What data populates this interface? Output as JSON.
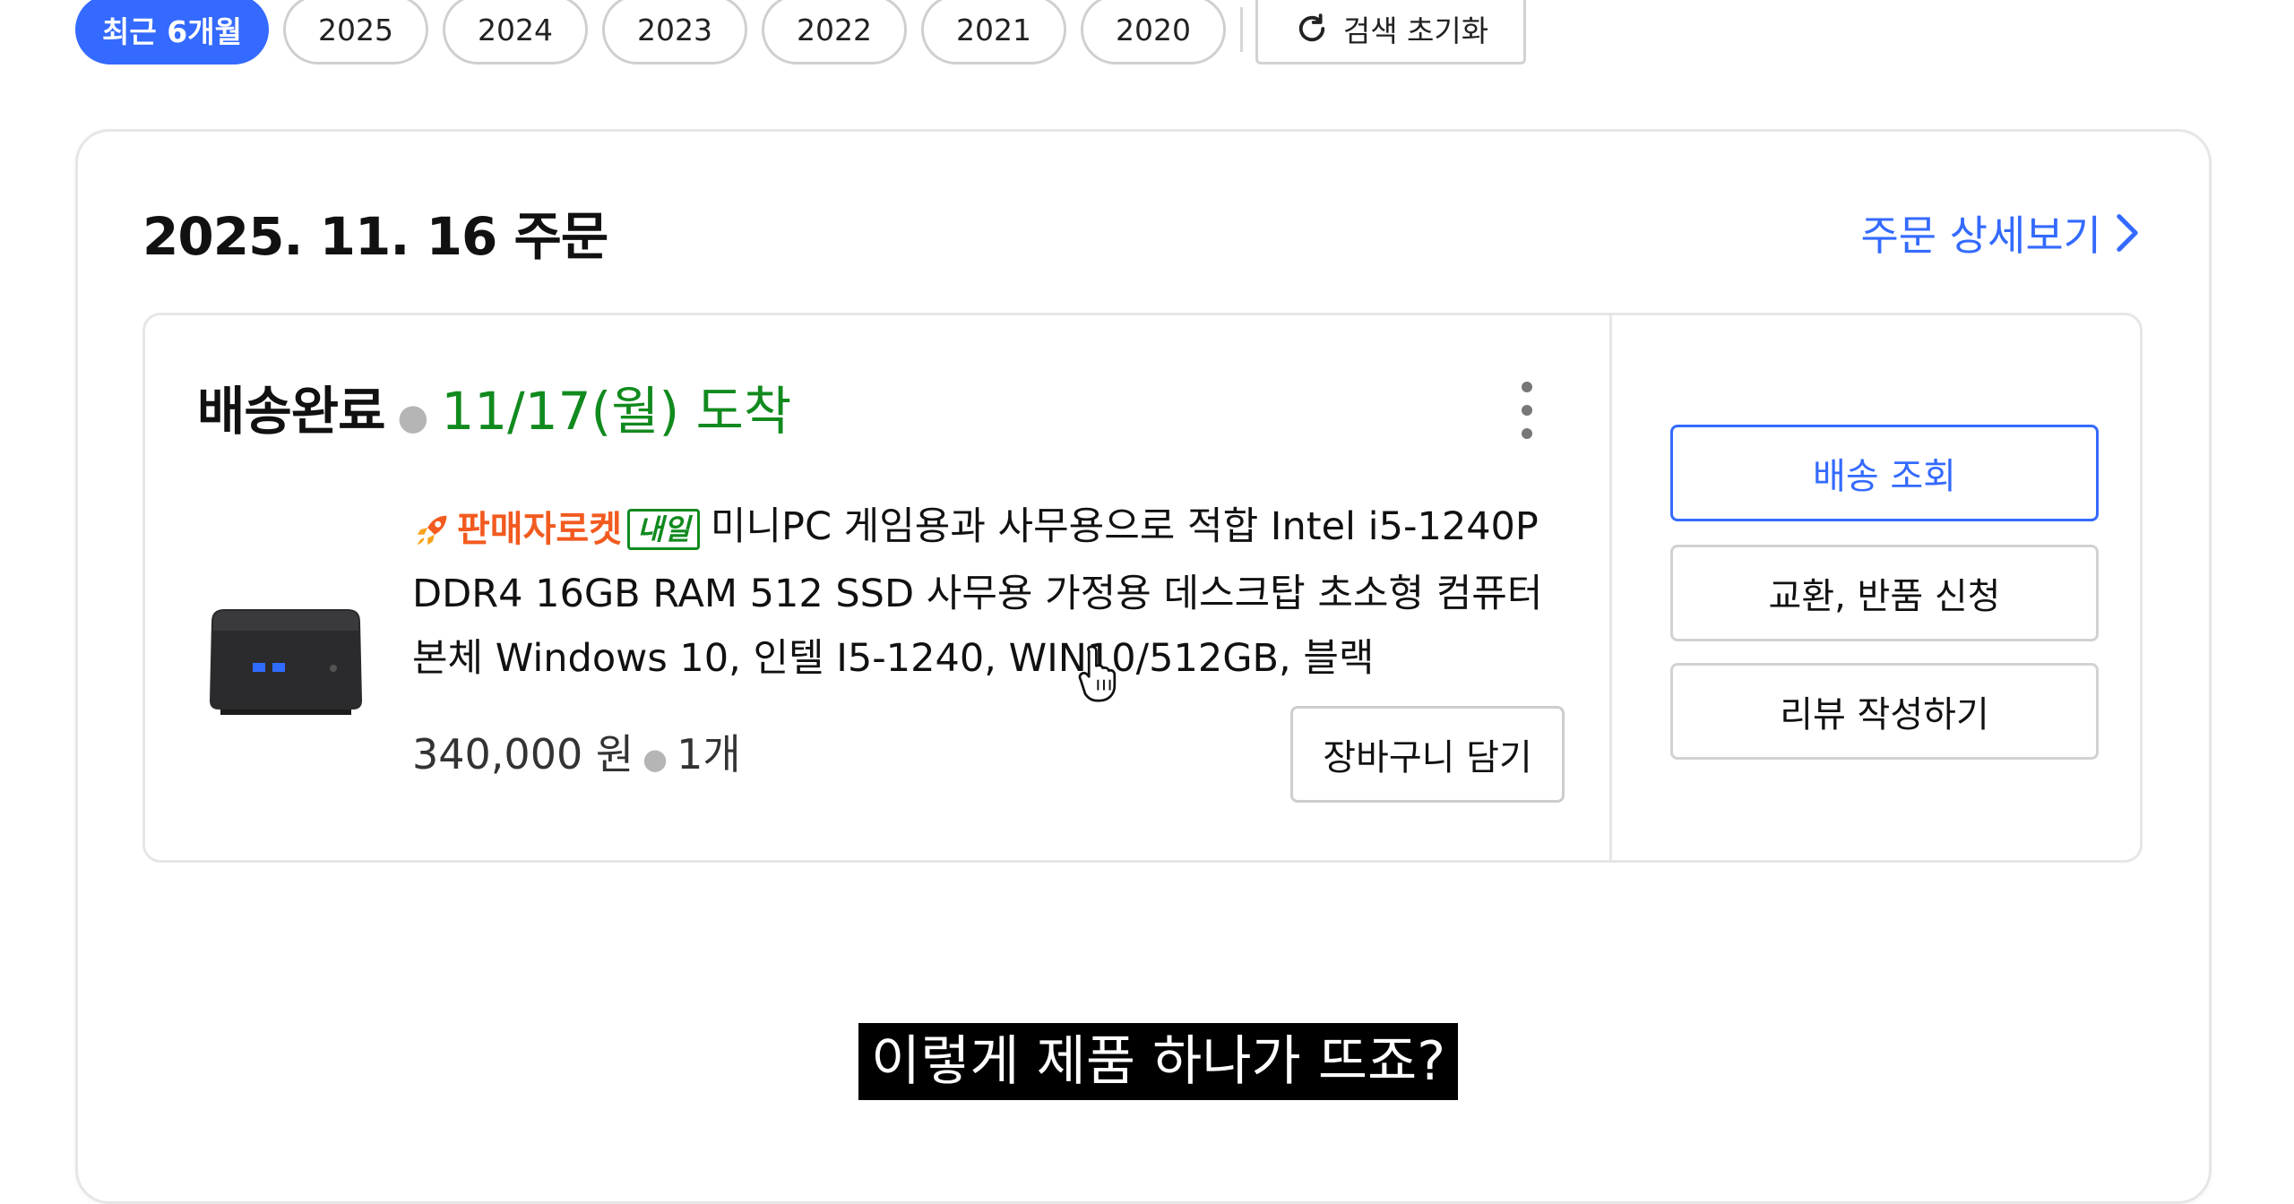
{
  "filters": {
    "items": [
      "최근 6개월",
      "2025",
      "2024",
      "2023",
      "2022",
      "2021",
      "2020"
    ],
    "active_index": 0,
    "reset_label": "검색 초기화"
  },
  "order": {
    "date": "2025. 11. 16 주문",
    "detail_link": "주문 상세보기",
    "status": "배송완료",
    "arrival": "11/17(월) 도착",
    "badge_rocket": "판매자로켓",
    "badge_tomorrow": "내일",
    "product_title": "미니PC 게임용과 사무용으로 적합 Intel i5-1240P DDR4 16GB RAM 512 SSD 사무용 가정용 데스크탑 초소형 컴퓨터 본체 Windows 10, 인텔 I5-1240, WIN10/512GB, 블랙",
    "price": "340,000 원",
    "quantity": "1개",
    "cart_button": "장바구니 담기",
    "actions": [
      "배송 조회",
      "교환, 반품 신청",
      "리뷰 작성하기"
    ]
  },
  "colors": {
    "accent": "#346aff",
    "arrival_green": "#118a1e",
    "rocket_orange": "#f25a1f"
  },
  "subtitle": "이렇게 제품 하나가 뜨죠?"
}
